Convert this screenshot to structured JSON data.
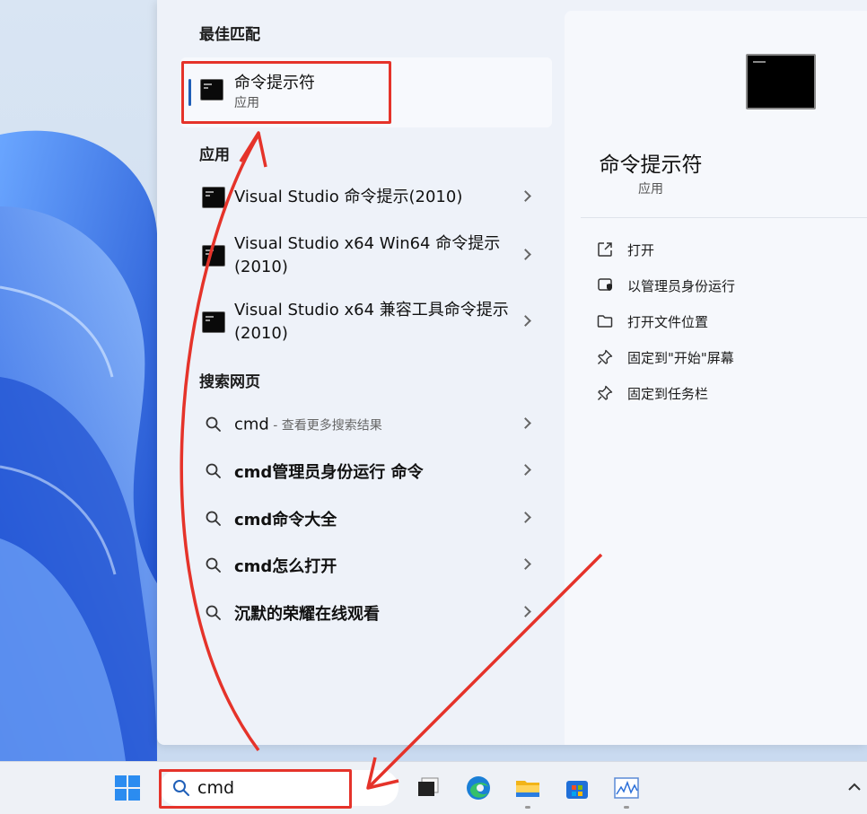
{
  "best_match": {
    "heading": "最佳匹配",
    "title": "命令提示符",
    "subtitle": "应用"
  },
  "apps": {
    "heading": "应用",
    "items": [
      {
        "label": "Visual Studio 命令提示(2010)"
      },
      {
        "label": "Visual Studio x64 Win64 命令提示(2010)"
      },
      {
        "label": "Visual Studio x64 兼容工具命令提示(2010)"
      }
    ]
  },
  "web": {
    "heading": "搜索网页",
    "first": {
      "query": "cmd",
      "hint": " - 查看更多搜索结果"
    },
    "items": [
      {
        "label": "cmd管理员身份运行 命令"
      },
      {
        "label": "cmd命令大全"
      },
      {
        "label": "cmd怎么打开"
      },
      {
        "label": "沉默的荣耀在线观看"
      }
    ]
  },
  "preview": {
    "title": "命令提示符",
    "subtitle": "应用",
    "actions": [
      {
        "label": "打开",
        "icon": "open-external-icon"
      },
      {
        "label": "以管理员身份运行",
        "icon": "shield-icon"
      },
      {
        "label": "打开文件位置",
        "icon": "folder-icon"
      },
      {
        "label": "固定到\"开始\"屏幕",
        "icon": "pin-icon"
      },
      {
        "label": "固定到任务栏",
        "icon": "pin-icon"
      }
    ]
  },
  "taskbar": {
    "search_value": "cmd",
    "icons": [
      "windows-start-icon",
      "task-view-icon",
      "edge-icon",
      "file-explorer-icon",
      "store-icon",
      "resource-monitor-icon",
      "chevron-up-icon"
    ]
  },
  "colors": {
    "accent": "#1f5fb8",
    "annotation": "#e5332a",
    "wallpaper": "#2e6ee8"
  }
}
